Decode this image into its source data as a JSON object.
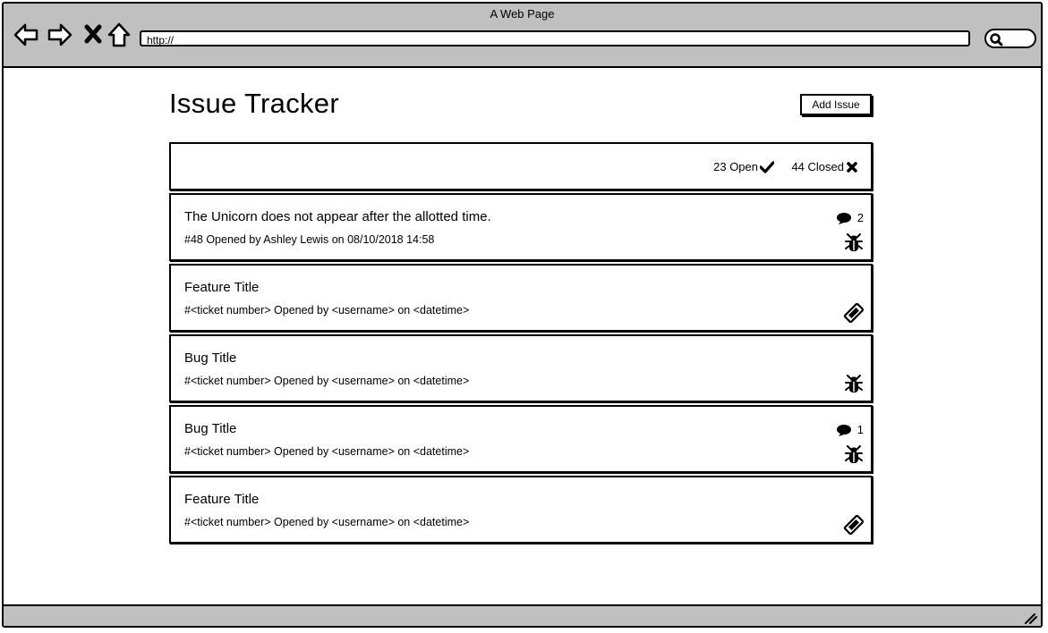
{
  "window": {
    "title": "A Web Page"
  },
  "address_bar": {
    "url": "http://"
  },
  "page": {
    "title": "Issue Tracker",
    "add_label": "Add Issue"
  },
  "filters": {
    "open_label": "23 Open",
    "closed_label": "44 Closed"
  },
  "issues": [
    {
      "title": "The Unicorn does not appear after the allotted time.",
      "meta": "#48 Opened by Ashley Lewis on 08/10/2018 14:58",
      "comments": "2",
      "type": "bug-icon"
    },
    {
      "title": "Feature Title",
      "meta": "#<ticket number> Opened by <username> on <datetime>",
      "comments": "",
      "type": "ticket-icon"
    },
    {
      "title": "Bug Title",
      "meta": "#<ticket number> Opened by <username> on <datetime>",
      "comments": "",
      "type": "bug-icon"
    },
    {
      "title": "Bug Title",
      "meta": "#<ticket number> Opened by <username> on <datetime>",
      "comments": "1",
      "type": "bug-icon"
    },
    {
      "title": "Feature Title",
      "meta": "#<ticket number> Opened by <username> on <datetime>",
      "comments": "",
      "type": "ticket-icon"
    }
  ]
}
